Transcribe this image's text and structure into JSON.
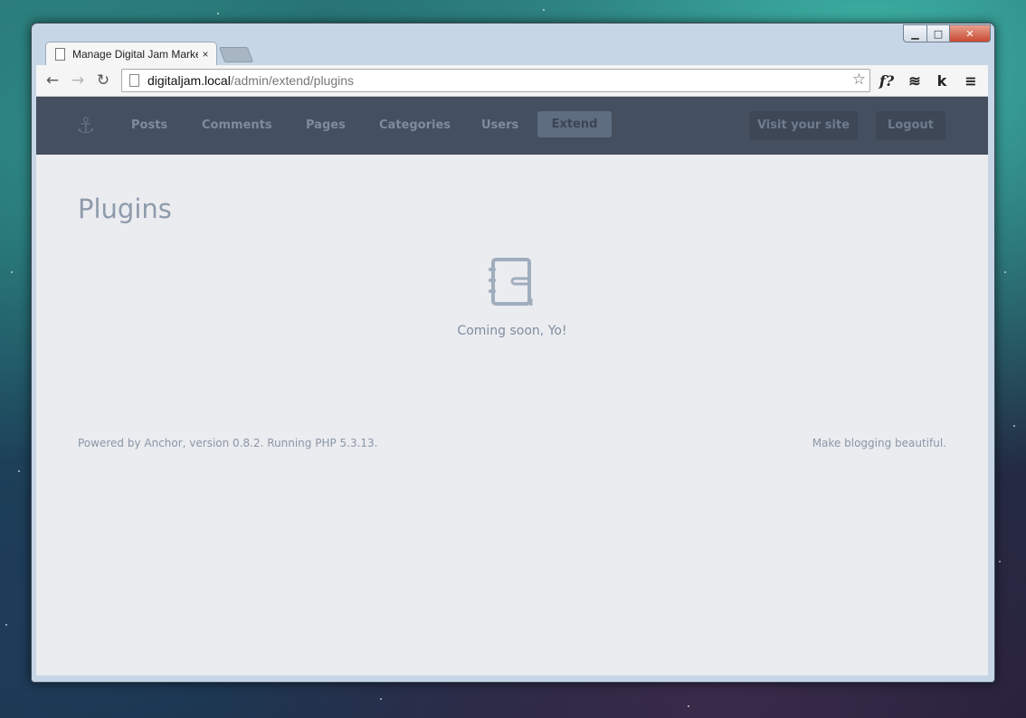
{
  "browser": {
    "tab_title": "Manage Digital Jam Marke",
    "tab_close": "×",
    "back": "←",
    "forward": "→",
    "reload": "↻",
    "url_host": "digitaljam.local",
    "url_path": "/admin/extend/plugins",
    "bookmark_star": "☆",
    "extensions": [
      "f?",
      "≋",
      "k"
    ],
    "menu": "≡",
    "window_controls": {
      "minimize": "▁",
      "maximize": "□",
      "close": "✕"
    }
  },
  "nav": {
    "logo_icon": "anchor-icon",
    "items": [
      {
        "label": "Posts"
      },
      {
        "label": "Comments"
      },
      {
        "label": "Pages"
      },
      {
        "label": "Categories"
      },
      {
        "label": "Users"
      },
      {
        "label": "Extend",
        "active": true
      }
    ],
    "visit_site": "Visit your site",
    "logout": "Logout"
  },
  "page": {
    "title": "Plugins",
    "empty_icon": "notebook-icon",
    "empty_message": "Coming soon, Yo!"
  },
  "footer": {
    "left": "Powered by Anchor, version 0.8.2. Running PHP 5.3.13.",
    "right": "Make blogging beautiful."
  },
  "colors": {
    "nav_bg": "#444f5f",
    "content_bg": "#ebecf0",
    "active_tab": "#5f6d81"
  }
}
